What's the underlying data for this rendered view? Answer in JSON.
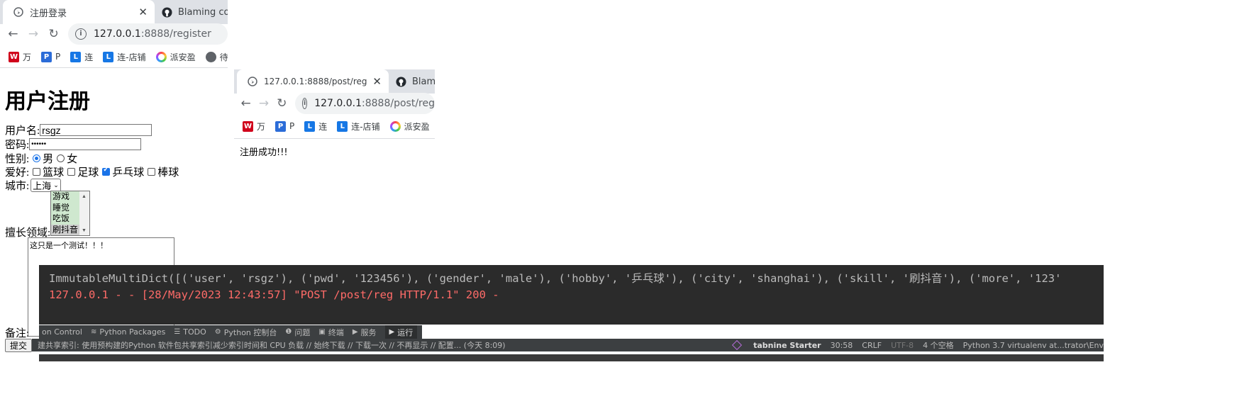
{
  "browser1": {
    "tabs": [
      {
        "title": "注册登录",
        "active": true,
        "icon": "globe-icon"
      },
      {
        "title": "Blaming code",
        "active": false,
        "icon": "github-icon"
      }
    ],
    "address": {
      "host": "127.0.0.1",
      "path": ":8888/register"
    },
    "bookmarks": [
      {
        "label": "万",
        "icon": "W"
      },
      {
        "label": "P",
        "icon": "P"
      },
      {
        "label": "连",
        "icon": "L"
      },
      {
        "label": "连-店铺",
        "icon": "L"
      },
      {
        "label": "派安盈",
        "icon": "ring"
      },
      {
        "label": "待",
        "icon": "globe"
      }
    ]
  },
  "browser2": {
    "tabs": [
      {
        "title": "127.0.0.1:8888/post/reg",
        "active": true,
        "icon": "globe-icon"
      },
      {
        "title": "Blamin",
        "active": false,
        "icon": "github-icon"
      }
    ],
    "address": {
      "host": "127.0.0.1",
      "path": ":8888/post/reg"
    },
    "bookmarks": [
      {
        "label": "万",
        "icon": "W"
      },
      {
        "label": "P",
        "icon": "P"
      },
      {
        "label": "连",
        "icon": "L"
      },
      {
        "label": "连-店铺",
        "icon": "L"
      },
      {
        "label": "派安盈",
        "icon": "ring"
      }
    ],
    "message": "注册成功!!!"
  },
  "form": {
    "heading": "用户注册",
    "username_label": "用户名:",
    "username_value": "rsgz",
    "password_label": "密码:",
    "password_value": "••••••",
    "gender_label": "性别:",
    "gender_options": [
      {
        "label": "男",
        "checked": true
      },
      {
        "label": "女",
        "checked": false
      }
    ],
    "hobby_label": "爱好:",
    "hobby_options": [
      {
        "label": "篮球",
        "checked": false
      },
      {
        "label": "足球",
        "checked": false
      },
      {
        "label": "乒乓球",
        "checked": true
      },
      {
        "label": "棒球",
        "checked": false
      }
    ],
    "city_label": "城市:",
    "city_value": "上海",
    "skill_label": "擅长领域:",
    "skill_options": [
      "游戏",
      "睡觉",
      "吃饭",
      "刷抖音"
    ],
    "notes_label": "备注:",
    "notes_value": "这只是一个测试！！！",
    "submit_label": "提交"
  },
  "terminal": {
    "line1": "ImmutableMultiDict([('user', 'rsgz'), ('pwd', '123456'), ('gender', 'male'), ('hobby', '乒乓球'), ('city', 'shanghai'), ('skill', '刷抖音'), ('more', '123'",
    "line2": "127.0.0.1 - - [28/May/2023 12:43:57] \"POST /post/reg HTTP/1.1\" 200 -"
  },
  "ide_toolbar": [
    {
      "label": "on Control",
      "icon": ""
    },
    {
      "label": "Python Packages",
      "icon": "≋"
    },
    {
      "label": "TODO",
      "icon": "☰"
    },
    {
      "label": "Python 控制台",
      "icon": "⚙"
    },
    {
      "label": "问题",
      "icon": "❶"
    },
    {
      "label": "终端",
      "icon": "▣"
    },
    {
      "label": "服务",
      "icon": "▶"
    },
    {
      "label": "运行",
      "icon": "▶"
    }
  ],
  "ide_status": {
    "message": "建共享索引: 使用预构建的Python 软件包共享索引减少索引时间和 CPU 负载 // 始终下载 // 下载一次 // 不再显示 // 配置... (今天 8:09)",
    "tabnine": "tabnine Starter",
    "position": "30:58",
    "line_ending": "CRLF",
    "encoding": "UTF-8",
    "indent": "4 个空格",
    "interpreter": "Python 3.7 virtualenv at...trator\\Env"
  },
  "colors": {
    "accent": "#1a73e8",
    "terminal_bg": "#2b2b2b",
    "terminal_error": "#ff6b68",
    "ide_bar": "#3c3f41"
  }
}
